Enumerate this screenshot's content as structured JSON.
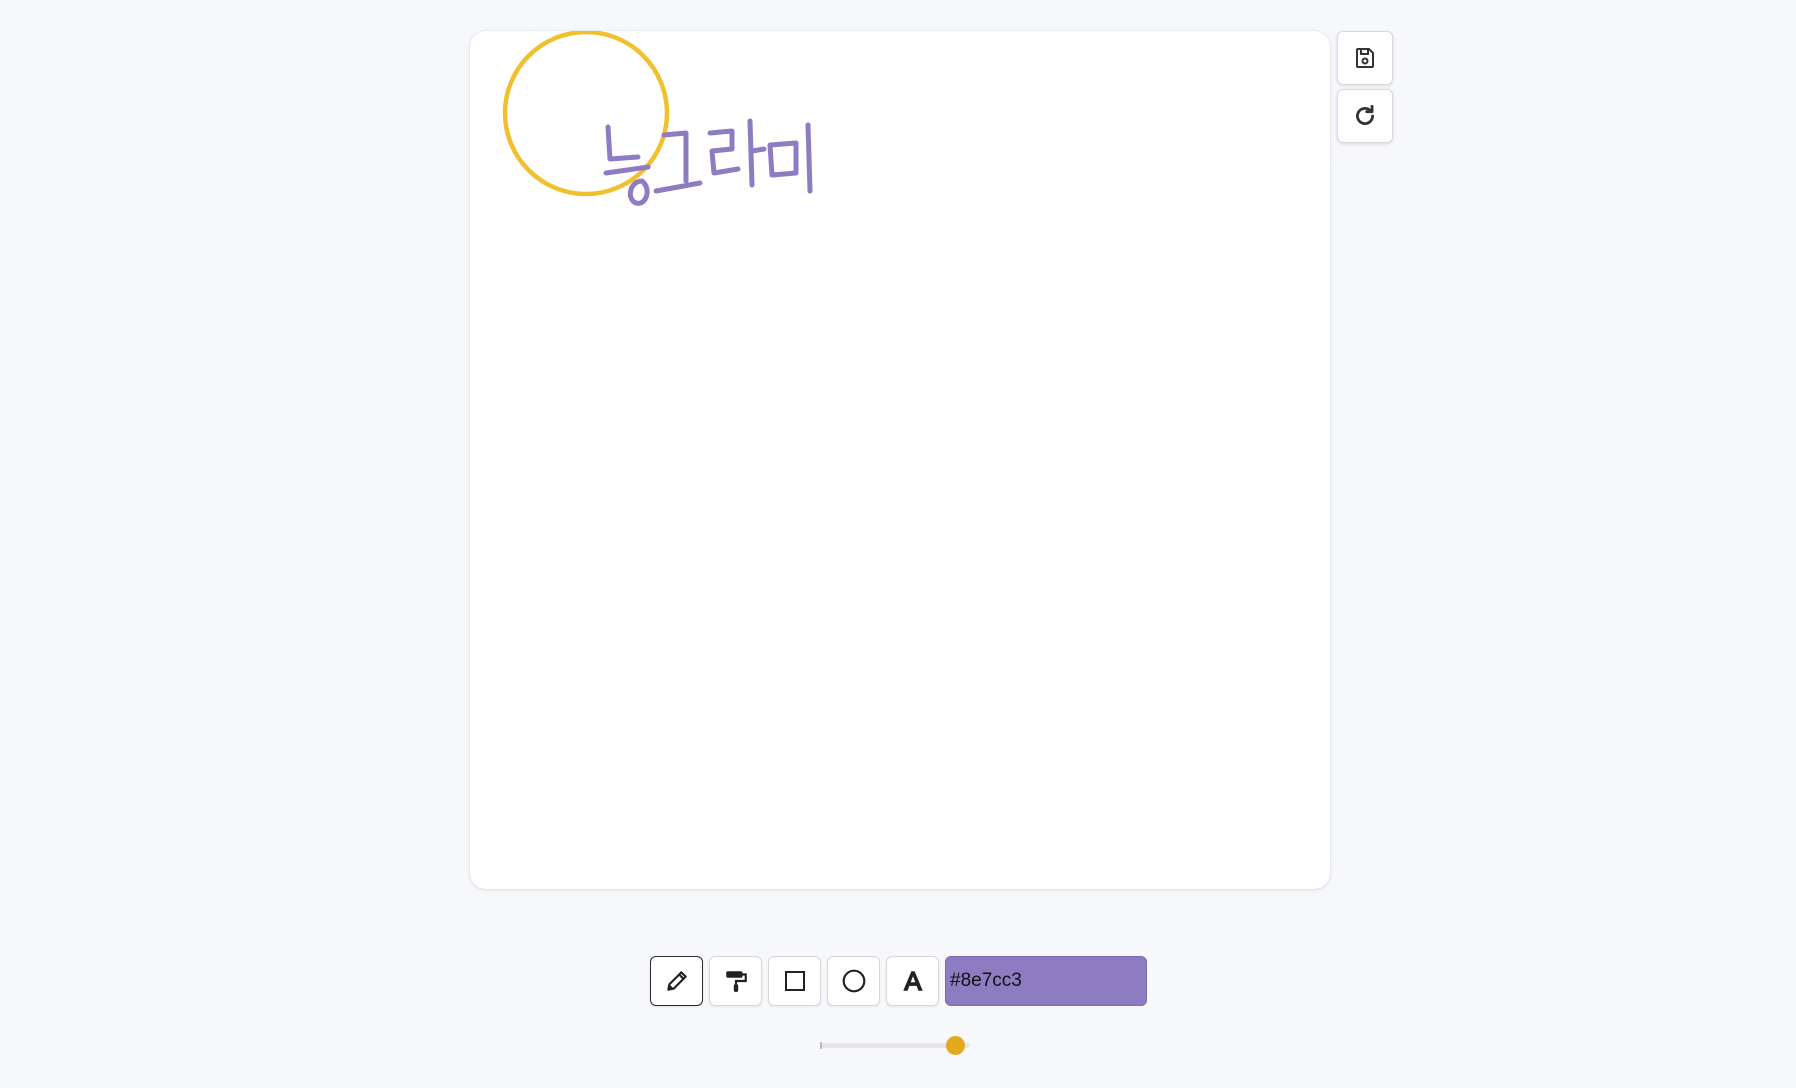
{
  "drawing": {
    "handwritten_text": "동그라미",
    "circle_color": "#f0c02e",
    "ink_color": "#8e7cc3"
  },
  "side_buttons": {
    "save_icon": "save-icon",
    "reset_icon": "refresh-icon"
  },
  "toolbar": {
    "tools": [
      {
        "name": "pencil",
        "icon": "pencil-icon",
        "active": true
      },
      {
        "name": "fill",
        "icon": "paint-roller-icon",
        "active": false
      },
      {
        "name": "rectangle",
        "icon": "square-icon",
        "active": false
      },
      {
        "name": "circle",
        "icon": "circle-icon",
        "active": false
      },
      {
        "name": "text",
        "icon": "text-icon",
        "active": false
      }
    ],
    "color_value": "#8e7cc3",
    "color_bg": "#8e7cc3"
  },
  "brush": {
    "size_fraction": 0.9,
    "thumb_color": "#e3a91f"
  }
}
